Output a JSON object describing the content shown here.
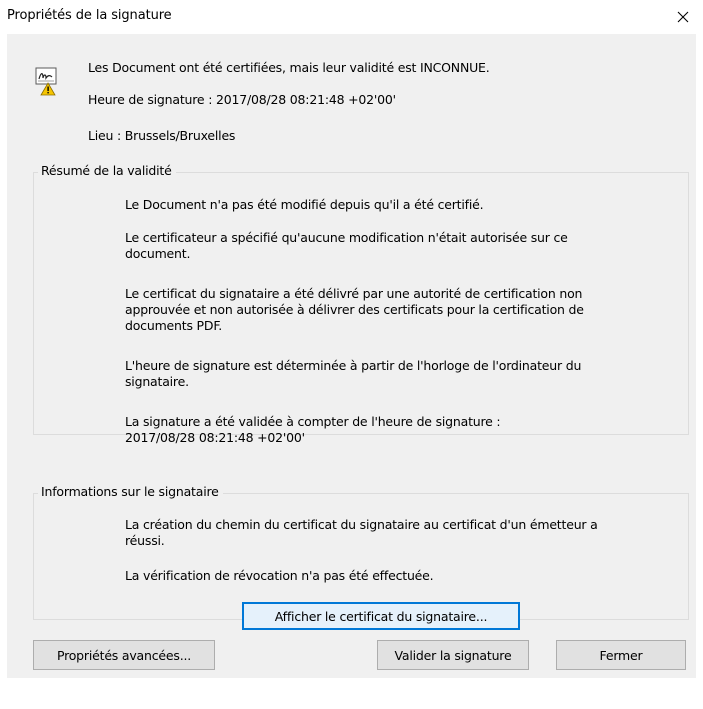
{
  "window": {
    "title": "Propriétés de la signature",
    "close_glyph": "✕"
  },
  "header": {
    "status": "Les Document ont été certifiées, mais leur validité est INCONNUE.",
    "signing_time": "Heure de signature : 2017/08/28 08:21:48 +02'00'",
    "location": "Lieu : Brussels/Bruxelles"
  },
  "validity": {
    "legend": "Résumé de la validité",
    "items": [
      [
        "Le Document n'a pas été modifié depuis qu'il a été certifié."
      ],
      [
        "Le certificateur a spécifié qu'aucune modification n'était autorisée sur ce",
        "document."
      ],
      [
        "Le certificat du signataire a été délivré par une autorité de certification non",
        "approuvée et non autorisée à délivrer des certificats pour la certification de",
        "documents PDF."
      ],
      [
        "L'heure de signature est déterminée à partir de l'horloge de l'ordinateur du",
        "signataire."
      ],
      [
        "La signature a été validée à compter de l'heure de signature :",
        "2017/08/28 08:21:48 +02'00'"
      ]
    ]
  },
  "signer": {
    "legend": "Informations sur le signataire",
    "items": [
      [
        "La création du chemin du certificat du signataire au certificat d'un émetteur a",
        "réussi."
      ],
      [
        "La vérification de révocation n'a pas été effectuée."
      ]
    ],
    "show_certificate_label": "Afficher le certificat du signataire..."
  },
  "footer": {
    "advanced_label": "Propriétés avancées...",
    "validate_label": "Valider la signature",
    "close_label": "Fermer"
  },
  "colors": {
    "dialog_bg": "#f0f0f0",
    "focus_border": "#0078d7",
    "warning_yellow": "#f5c400"
  }
}
